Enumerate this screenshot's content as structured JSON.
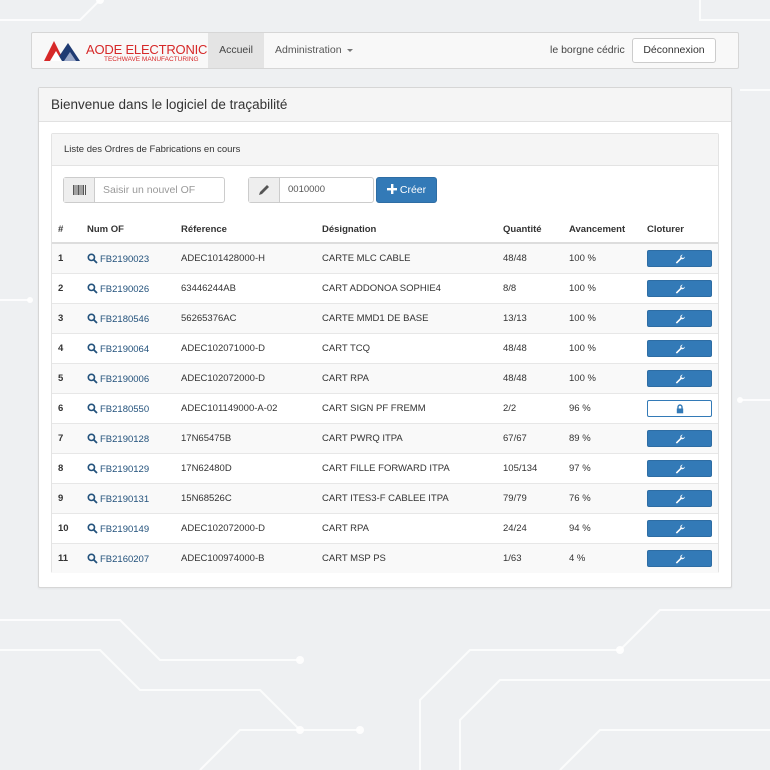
{
  "brand": {
    "name": "AODE ELECTRONICS",
    "tagline": "TECHWAVE MANUFACTURING"
  },
  "nav": {
    "home_label": "Accueil",
    "admin_label": "Administration",
    "user_name": "le borgne cédric",
    "logout_label": "Déconnexion"
  },
  "page": {
    "title": "Bienvenue dans le logiciel de traçabilité",
    "section_title": "Liste des Ordres de Fabrications en cours"
  },
  "form": {
    "new_of_placeholder": "Saisir un nouvel OF",
    "code_value": "0010000",
    "create_label": "Créer"
  },
  "table": {
    "headers": [
      "#",
      "Num OF",
      "Réference",
      "Désignation",
      "Quantité",
      "Avancement",
      "Cloturer"
    ],
    "rows": [
      {
        "n": "1",
        "of": "FB2190023",
        "ref": "ADEC101428000-H",
        "des": "CARTE MLC CABLE",
        "qty": "48/48",
        "adv": "100 %",
        "action": "wrench"
      },
      {
        "n": "2",
        "of": "FB2190026",
        "ref": "63446244AB",
        "des": "CART ADDONOA SOPHIE4",
        "qty": "8/8",
        "adv": "100 %",
        "action": "wrench"
      },
      {
        "n": "3",
        "of": "FB2180546",
        "ref": "56265376AC",
        "des": "CARTE MMD1 DE BASE",
        "qty": "13/13",
        "adv": "100 %",
        "action": "wrench"
      },
      {
        "n": "4",
        "of": "FB2190064",
        "ref": "ADEC102071000-D",
        "des": "CART TCQ",
        "qty": "48/48",
        "adv": "100 %",
        "action": "wrench"
      },
      {
        "n": "5",
        "of": "FB2190006",
        "ref": "ADEC102072000-D",
        "des": "CART RPA",
        "qty": "48/48",
        "adv": "100 %",
        "action": "wrench"
      },
      {
        "n": "6",
        "of": "FB2180550",
        "ref": "ADEC101149000-A-02",
        "des": "CART SIGN PF FREMM",
        "qty": "2/2",
        "adv": "96 %",
        "action": "lock"
      },
      {
        "n": "7",
        "of": "FB2190128",
        "ref": "17N65475B",
        "des": "CART PWRQ ITPA",
        "qty": "67/67",
        "adv": "89 %",
        "action": "wrench"
      },
      {
        "n": "8",
        "of": "FB2190129",
        "ref": "17N62480D",
        "des": "CART FILLE FORWARD ITPA",
        "qty": "105/134",
        "adv": "97 %",
        "action": "wrench"
      },
      {
        "n": "9",
        "of": "FB2190131",
        "ref": "15N68526C",
        "des": "CART ITES3-F CABLEE ITPA",
        "qty": "79/79",
        "adv": "76 %",
        "action": "wrench"
      },
      {
        "n": "10",
        "of": "FB2190149",
        "ref": "ADEC102072000-D",
        "des": "CART RPA",
        "qty": "24/24",
        "adv": "94 %",
        "action": "wrench"
      },
      {
        "n": "11",
        "of": "FB2160207",
        "ref": "ADEC100974000-B",
        "des": "CART MSP PS",
        "qty": "1/63",
        "adv": "4 %",
        "action": "wrench"
      }
    ]
  },
  "colors": {
    "primary": "#337ab7",
    "link": "#23527c",
    "brand": "#d62828"
  },
  "icons": {
    "barcode": "barcode-icon",
    "pencil": "pencil-icon",
    "plus": "plus-icon",
    "search": "search-icon",
    "wrench": "wrench-icon",
    "lock": "lock-icon"
  }
}
